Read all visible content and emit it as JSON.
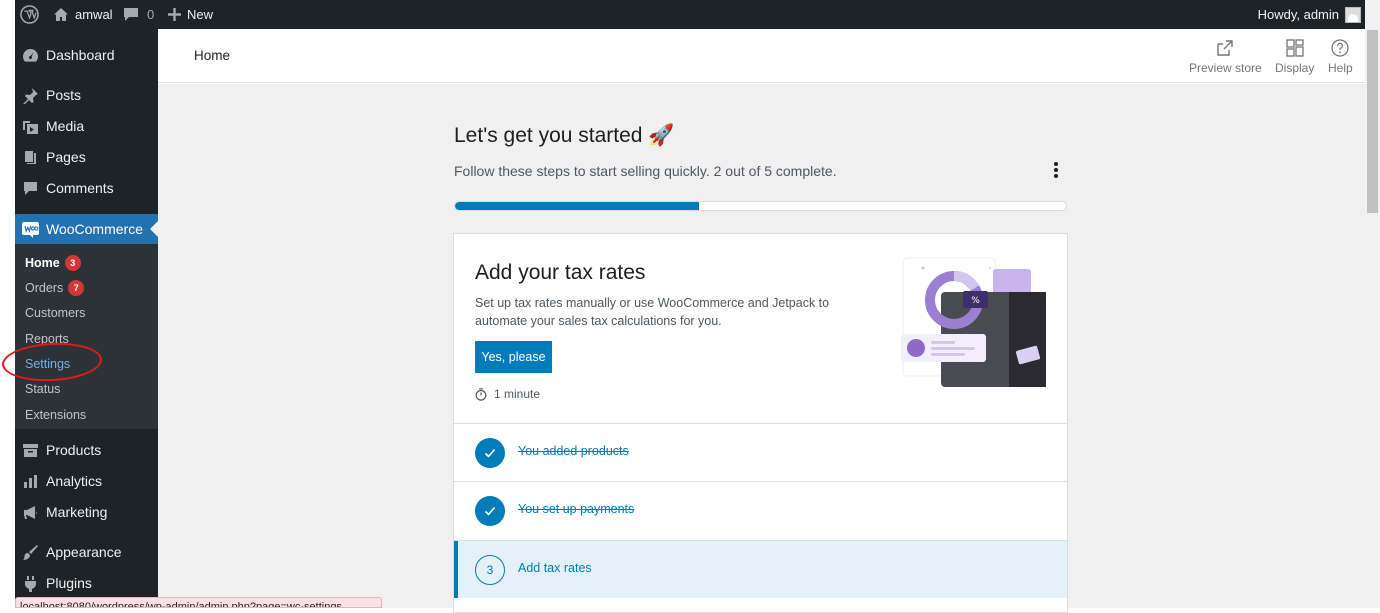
{
  "adminbar": {
    "site_name": "amwal",
    "comments_count": "0",
    "new_label": "New",
    "howdy": "Howdy, admin"
  },
  "sidebar": {
    "items_top": [
      {
        "label": "Dashboard",
        "icon": "dashboard-icon"
      },
      {
        "label": "Posts",
        "icon": "pin-icon"
      },
      {
        "label": "Media",
        "icon": "media-icon"
      },
      {
        "label": "Pages",
        "icon": "pages-icon"
      },
      {
        "label": "Comments",
        "icon": "comments-icon"
      }
    ],
    "woocommerce": "WooCommerce",
    "sub": [
      {
        "label": "Home",
        "badge": "3"
      },
      {
        "label": "Orders",
        "badge": "7"
      },
      {
        "label": "Customers"
      },
      {
        "label": "Reports"
      },
      {
        "label": "Settings"
      },
      {
        "label": "Status"
      },
      {
        "label": "Extensions"
      }
    ],
    "items_bottom": [
      {
        "label": "Products",
        "icon": "products-icon"
      },
      {
        "label": "Analytics",
        "icon": "analytics-icon"
      },
      {
        "label": "Marketing",
        "icon": "megaphone-icon"
      },
      {
        "label": "Appearance",
        "icon": "brush-icon"
      },
      {
        "label": "Plugins",
        "icon": "plugin-icon"
      }
    ],
    "annotation_color": "#e2191b"
  },
  "status_url": "localhost:8080/wordpress/wp-admin/admin.php?page=wc-settings",
  "header": {
    "title": "Home",
    "preview_store": "Preview store",
    "display": "Display",
    "help": "Help"
  },
  "setup": {
    "title": "Let's get you started 🚀",
    "subtitle": "Follow these steps to start selling quickly. 2 out of 5 complete.",
    "progress": 0.4,
    "card_title": "Add your tax rates",
    "card_desc": "Set up tax rates manually or use WooCommerce and Jetpack to automate your sales tax calculations for you.",
    "button": "Yes, please",
    "time": "1 minute",
    "percent_symbol": "%",
    "tasks": [
      {
        "label": "You added products",
        "done": true
      },
      {
        "label": "You set up payments",
        "done": true
      },
      {
        "label": "Add tax rates",
        "number": "3",
        "done": false
      }
    ]
  },
  "colors": {
    "admin_dark": "#1d2327",
    "accent": "#2271b1",
    "wc_blue": "#007cba",
    "purple": "#9b7fd1"
  }
}
